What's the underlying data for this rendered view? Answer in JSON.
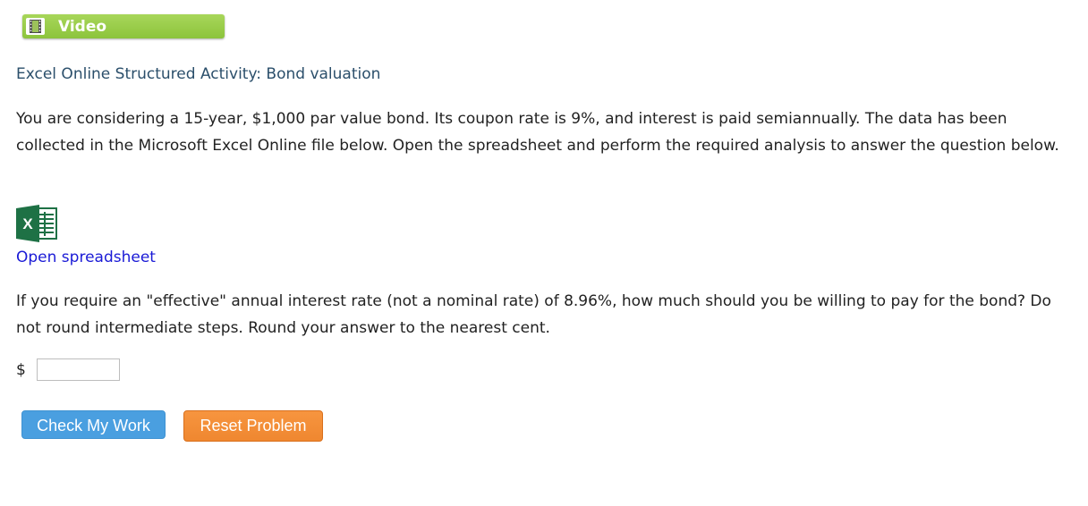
{
  "video": {
    "icon": "film-icon",
    "label": "Video"
  },
  "activity_title": "Excel Online Structured Activity: Bond valuation",
  "intro_text": "You are considering a 15-year, $1,000 par value bond. Its coupon rate is 9%, and interest is paid semiannually. The data has been collected in the Microsoft Excel Online file below. Open the spreadsheet and perform the required analysis to answer the question below.",
  "spreadsheet": {
    "icon": "excel-icon",
    "link_label": "Open spreadsheet"
  },
  "question_text": "If you require an \"effective\" annual interest rate (not a nominal rate) of 8.96%, how much should you be willing to pay for the bond? Do not round intermediate steps. Round your answer to the nearest cent.",
  "answer": {
    "currency_symbol": "$",
    "value": ""
  },
  "buttons": {
    "check_label": "Check My Work",
    "reset_label": "Reset Problem"
  },
  "colors": {
    "video_green": "#8cc43c",
    "title_blue": "#2b4f6b",
    "link_blue": "#1a1ad6",
    "check_blue": "#4a9fe0",
    "reset_orange": "#f08a35",
    "excel_green": "#1e7145"
  }
}
